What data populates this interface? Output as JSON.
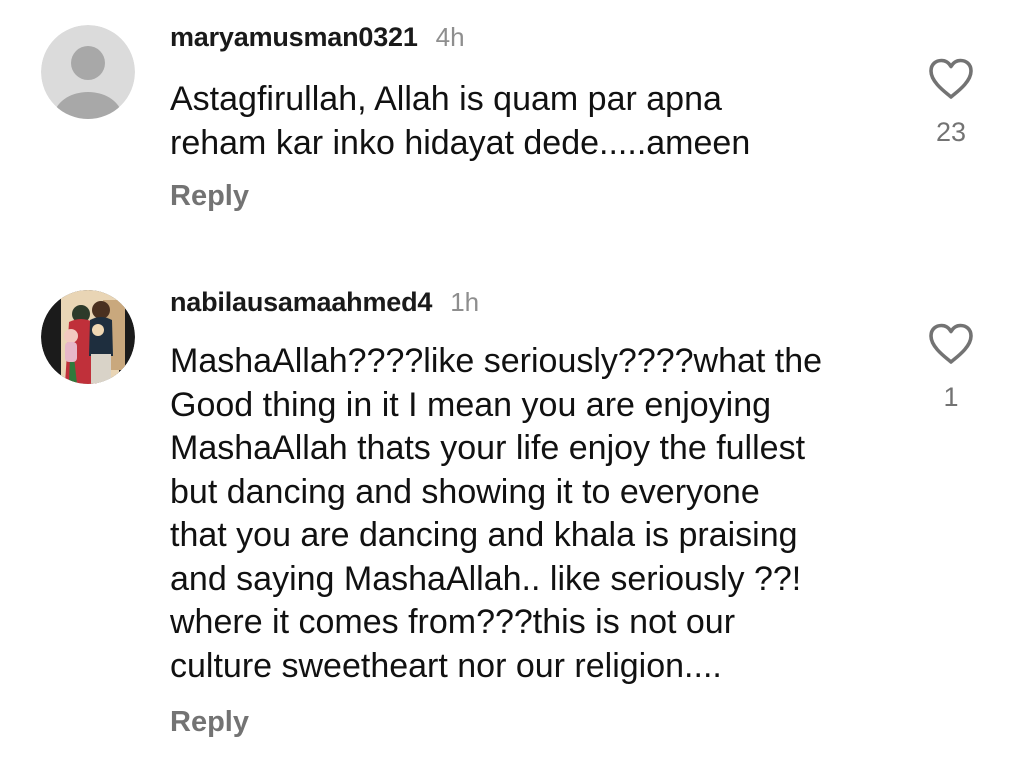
{
  "comments": [
    {
      "username": "maryamusman0321",
      "timestamp": "4h",
      "lines": [
        "Astagfirullah, Allah is quam par apna",
        "reham kar inko hidayat dede.....ameen"
      ],
      "reply_label": "Reply",
      "like_count": "23",
      "avatar_icon": "default-profile-icon"
    },
    {
      "username": "nabilausamaahmed4",
      "timestamp": "1h",
      "lines": [
        "MashaAllah????like seriously????what the",
        "Good thing in it I mean you are enjoying",
        "MashaAllah thats your life enjoy the fullest",
        "but dancing and showing it to everyone",
        "that you are dancing and khala is praising",
        "and saying MashaAllah.. like seriously ??!",
        "where it comes from???this is not our",
        "culture sweetheart nor our religion...."
      ],
      "reply_label": "Reply",
      "like_count": "1",
      "avatar_icon": "family-photo-avatar"
    }
  ],
  "colors": {
    "text": "#111111",
    "muted": "#737373",
    "timestamp": "#8e8e8e",
    "default_avatar_bg": "#dbdbdb",
    "default_avatar_fg": "#c7c7c7"
  }
}
